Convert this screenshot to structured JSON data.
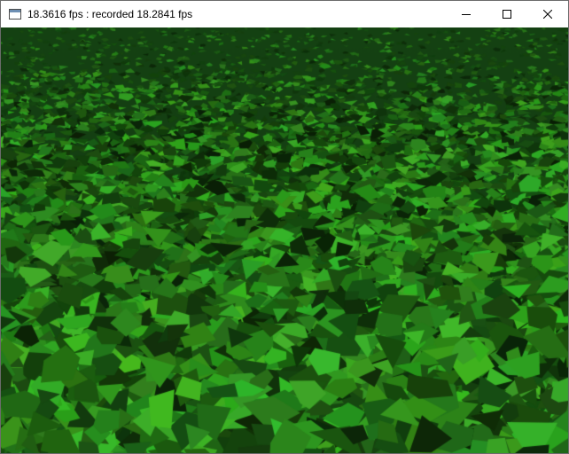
{
  "window": {
    "title": "18.3616 fps : recorded 18.2841 fps",
    "controls": {
      "minimize": "minimize-icon",
      "maximize": "maximize-icon",
      "close": "close-icon"
    }
  },
  "scene": {
    "description_colors": {
      "dark": "#0f3a0d",
      "mid": "#2a7a24",
      "light": "#3fa038"
    }
  }
}
